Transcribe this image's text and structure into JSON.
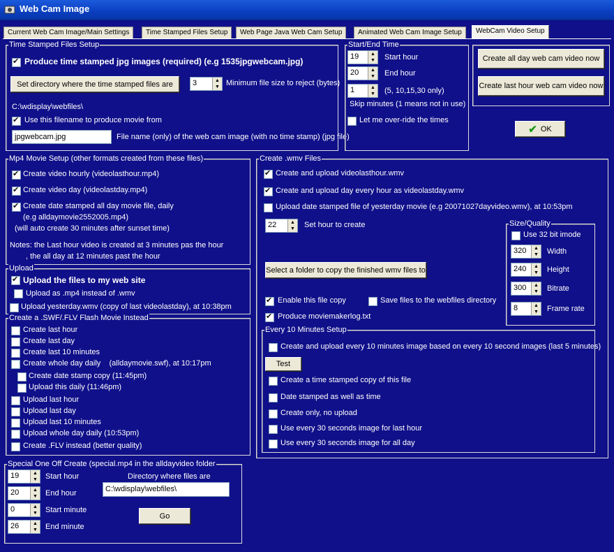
{
  "window": {
    "title": "Web Cam Image"
  },
  "tabs": [
    {
      "label": "Current Web Cam Image/Main Settings"
    },
    {
      "label": "Time Stamped Files Setup"
    },
    {
      "label": "Web Page Java Web Cam Setup"
    },
    {
      "label": "Animated Web Cam Image Setup"
    },
    {
      "label": "WebCam Video Setup"
    }
  ],
  "time_stamped": {
    "title": "Time Stamped Files Setup",
    "produce_label": "Produce time stamped jpg images (required) (e.g 1535jpgwebcam.jpg)",
    "set_dir_button": "Set directory where the time stamped files are",
    "min_size_value": "3",
    "min_size_label": "Minimum file size to reject (bytes)",
    "dir_path": "C:\\wdisplay\\webfiles\\",
    "use_filename_label": "Use this filename to produce movie from",
    "filename_value": "jpgwebcam.jpg",
    "filename_label": "File name (only) of the web cam image (with no time stamp) (jpg file)"
  },
  "start_end": {
    "title": "Start/End Time",
    "start_value": "19",
    "start_label": "Start hour",
    "end_value": "20",
    "end_label": "End hour",
    "skip_value": "1",
    "skip_hint": "(5, 10,15,30 only)",
    "skip_label": "Skip minutes (1 means not in use)",
    "override_label": "Let me over-ride the times"
  },
  "actions": {
    "all_day_button": "Create all day web cam video now",
    "last_hour_button": "Create last hour web cam video now",
    "ok_button": "OK"
  },
  "mp4": {
    "title": "Mp4 Movie Setup (other formats created from these files)",
    "hourly_label": "Create video hourly (videolasthour.mp4)",
    "day_label": "Create video day  (videolastday.mp4)",
    "stamped_label": "Create date stamped all day movie file, daily",
    "stamped_eg": "(e.g alldaymovie2552005.mp4)",
    "stamped_note": "(will auto create 30 minutes after sunset time)",
    "notes1": "Notes: the Last hour video is created at 3 minutes pas the hour",
    ", the all day at 12 minutes past the hour": null,
    "notes2": ", the all day at 12 minutes past the hour"
  },
  "upload": {
    "title": "Upload",
    "upload_label": "Upload the files to my web site",
    "as_mp4_label": "Upload as .mp4 instead of .wmv",
    "yesterday_label": "Upload yesterday.wmv (copy of last videolastday), at 10:38pm"
  },
  "swf": {
    "title": "Create a .SWF/.FLV Flash Movie Instead",
    "items": [
      "Create last hour",
      "Create last day",
      "Create last 10 minutes",
      "Create whole day daily    (alldaymovie.swf), at 10:17pm",
      "Create date stamp copy (11:45pm)",
      "Upload this daily (11:46pm)",
      "Upload last hour",
      "Upload last day",
      "Upload last 10 minutes",
      "Upload whole day daily (10:53pm)",
      "Create .FLV instead (better quality)"
    ]
  },
  "special": {
    "title": "Special One Off Create (special.mp4 in the alldayvideo folder",
    "start_hour_value": "19",
    "start_hour_label": "Start hour",
    "end_hour_value": "20",
    "end_hour_label": "End hour",
    "start_min_value": "0",
    "start_min_label": "Start minute",
    "end_min_value": "26",
    "end_min_label": "End minute",
    "dir_label": "Directory where files are",
    "dir_value": "C:\\wdisplay\\webfiles\\",
    "go_button": "Go"
  },
  "wmv": {
    "title": "Create .wmv Files",
    "last_hour_label": "Create and upload videolasthour.wmv",
    "day_label": "Create and upload day every hour as videolastday.wmv",
    "yesterday_label": "Upload date stamped file of yesterday movie (e.g 20071027dayvideo.wmv), at 10:53pm",
    "set_hour_value": "22",
    "set_hour_label": "Set hour to create",
    "folder_button": "Select a folder to copy the finished wmv files to",
    "enable_copy_label": "Enable this file copy",
    "save_webfiles_label": "Save files to the webfiles directory",
    "moviemaker_label": "Produce moviemakerlog.txt"
  },
  "size_quality": {
    "title": "Size/Quality",
    "use32_label": "Use 32 bit imode",
    "width_value": "320",
    "width_label": "Width",
    "height_value": "240",
    "height_label": "Height",
    "bitrate_value": "300",
    "bitrate_label": "Bitrate",
    "framerate_value": "8",
    "framerate_label": "Frame rate"
  },
  "every10": {
    "title": "Every 10 Minutes Setup",
    "create_upload_label": "Create and upload every 10 minutes image based on every 10 second images (last 5 minutes)",
    "test_button": "Test",
    "items": [
      "Create a time stamped copy of this file",
      "Date stamped as well as time",
      "Create only, no upload",
      "Use every 30 seconds image for last hour",
      "Use every 30 seconds image for all day"
    ]
  }
}
